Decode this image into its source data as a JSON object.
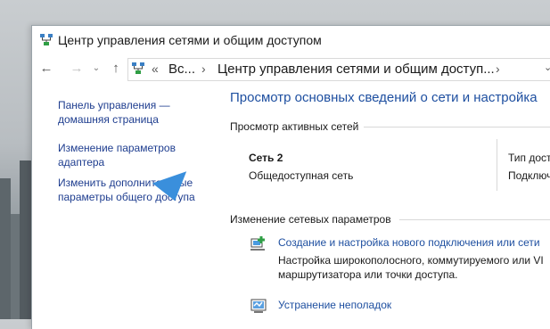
{
  "window": {
    "title": "Центр управления сетями и общим доступом"
  },
  "nav": {
    "back_icon": "arrow-left-icon",
    "forward_icon": "arrow-right-icon",
    "up_icon": "arrow-up-icon",
    "overflow": "«",
    "crumb_root": "Вс...",
    "crumb_current": "Центр управления сетями и общим доступ...",
    "dropdown_icon": "chevron-down-icon"
  },
  "sidebar": {
    "items": [
      {
        "label": "Панель управления — домашняя страница"
      },
      {
        "label": "Изменение параметров адаптера"
      },
      {
        "label": "Изменить дополнительные параметры общего доступа"
      }
    ]
  },
  "main": {
    "heading": "Просмотр основных сведений о сети и настройка",
    "active_title": "Просмотр активных сетей",
    "network": {
      "name": "Сеть  2",
      "type": "Общедоступная сеть",
      "access_label": "Тип дост",
      "connections_label": "Подключ"
    },
    "change_title": "Изменение сетевых параметров",
    "tasks": [
      {
        "link": "Создание и настройка нового подключения или сети",
        "desc_line1": "Настройка широкополосного, коммутируемого или VI",
        "desc_line2": "маршрутизатора или точки доступа.",
        "icon": "new-connection-icon"
      },
      {
        "link": "Устранение неполадок",
        "desc_line1": "",
        "desc_line2": "",
        "icon": "troubleshoot-icon"
      }
    ]
  },
  "colors": {
    "link": "#1e4fa0",
    "sidebar_link": "#1e3d8f",
    "cursor": "#3a8fdc"
  }
}
